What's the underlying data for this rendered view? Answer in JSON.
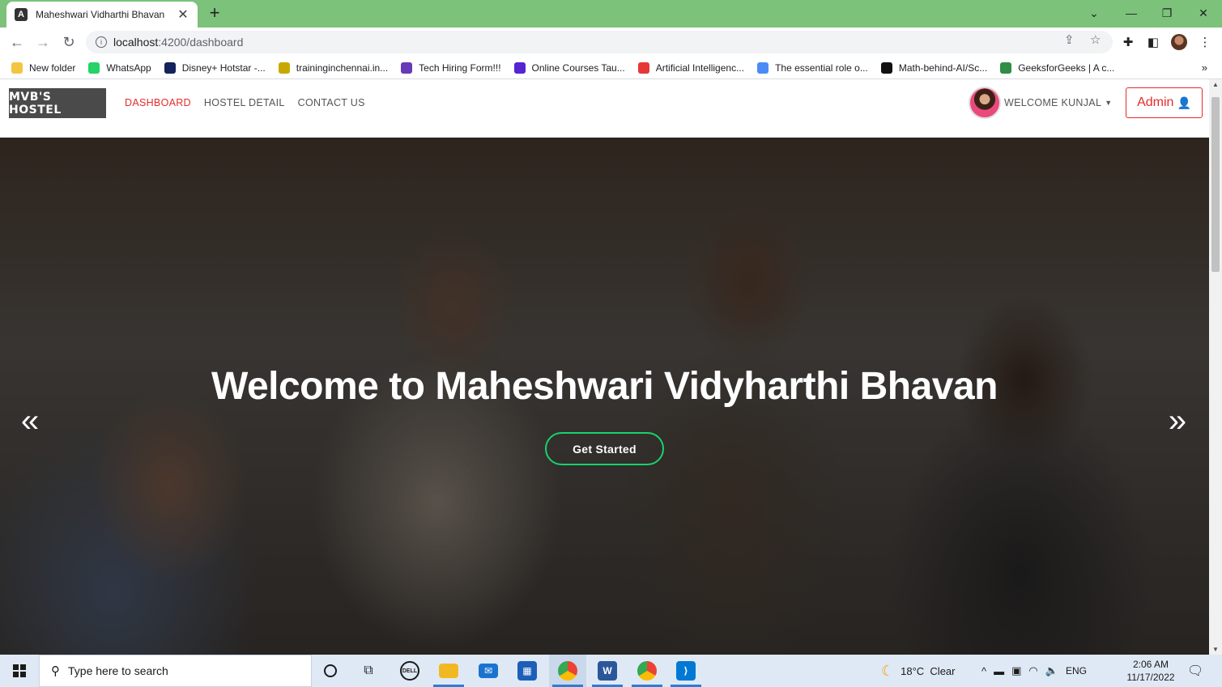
{
  "browser": {
    "tab_title": "Maheshwari Vidharthi Bhavan",
    "tab_favicon": "A",
    "url_host": "localhost",
    "url_rest": ":4200/dashboard",
    "bookmarks": [
      {
        "label": "New folder",
        "icon": "folder-icon",
        "color": "#f4c542"
      },
      {
        "label": "WhatsApp",
        "icon": "whatsapp-icon",
        "color": "#25d366"
      },
      {
        "label": "Disney+ Hotstar -...",
        "icon": "hotstar-icon",
        "color": "#13235c"
      },
      {
        "label": "traininginchennai.in...",
        "icon": "bulb-icon",
        "color": "#c8a800"
      },
      {
        "label": "Tech Hiring Form!!!",
        "icon": "form-icon",
        "color": "#673ab7"
      },
      {
        "label": "Online Courses Tau...",
        "icon": "udemy-icon",
        "color": "#5624d0"
      },
      {
        "label": "Artificial Intelligenc...",
        "icon": "flag-icon",
        "color": "#e53935"
      },
      {
        "label": "The essential role o...",
        "icon": "brain-icon",
        "color": "#4c8bf5"
      },
      {
        "label": "Math-behind-AI/Sc...",
        "icon": "github-icon",
        "color": "#111111"
      },
      {
        "label": "GeeksforGeeks | A c...",
        "icon": "gfg-icon",
        "color": "#2f8d46"
      }
    ]
  },
  "header": {
    "logo": "MVB'S HOSTEL",
    "nav": [
      "DASHBOARD",
      "HOSTEL DETAIL",
      "CONTACT US"
    ],
    "active_nav": "DASHBOARD",
    "welcome": "WELCOME KUNJAL",
    "admin_label": "Admin",
    "accent": "#e52b2b"
  },
  "hero": {
    "title": "Welcome to Maheshwari Vidyharthi Bhavan",
    "cta": "Get Started",
    "cta_border": "#18d26e",
    "prev_icon": "chevron-double-left-icon",
    "next_icon": "chevron-double-right-icon"
  },
  "taskbar": {
    "search_placeholder": "Type here to search",
    "weather": "18°C  Clear",
    "language": "ENG",
    "time": "2:06 AM",
    "date": "11/17/2022"
  }
}
